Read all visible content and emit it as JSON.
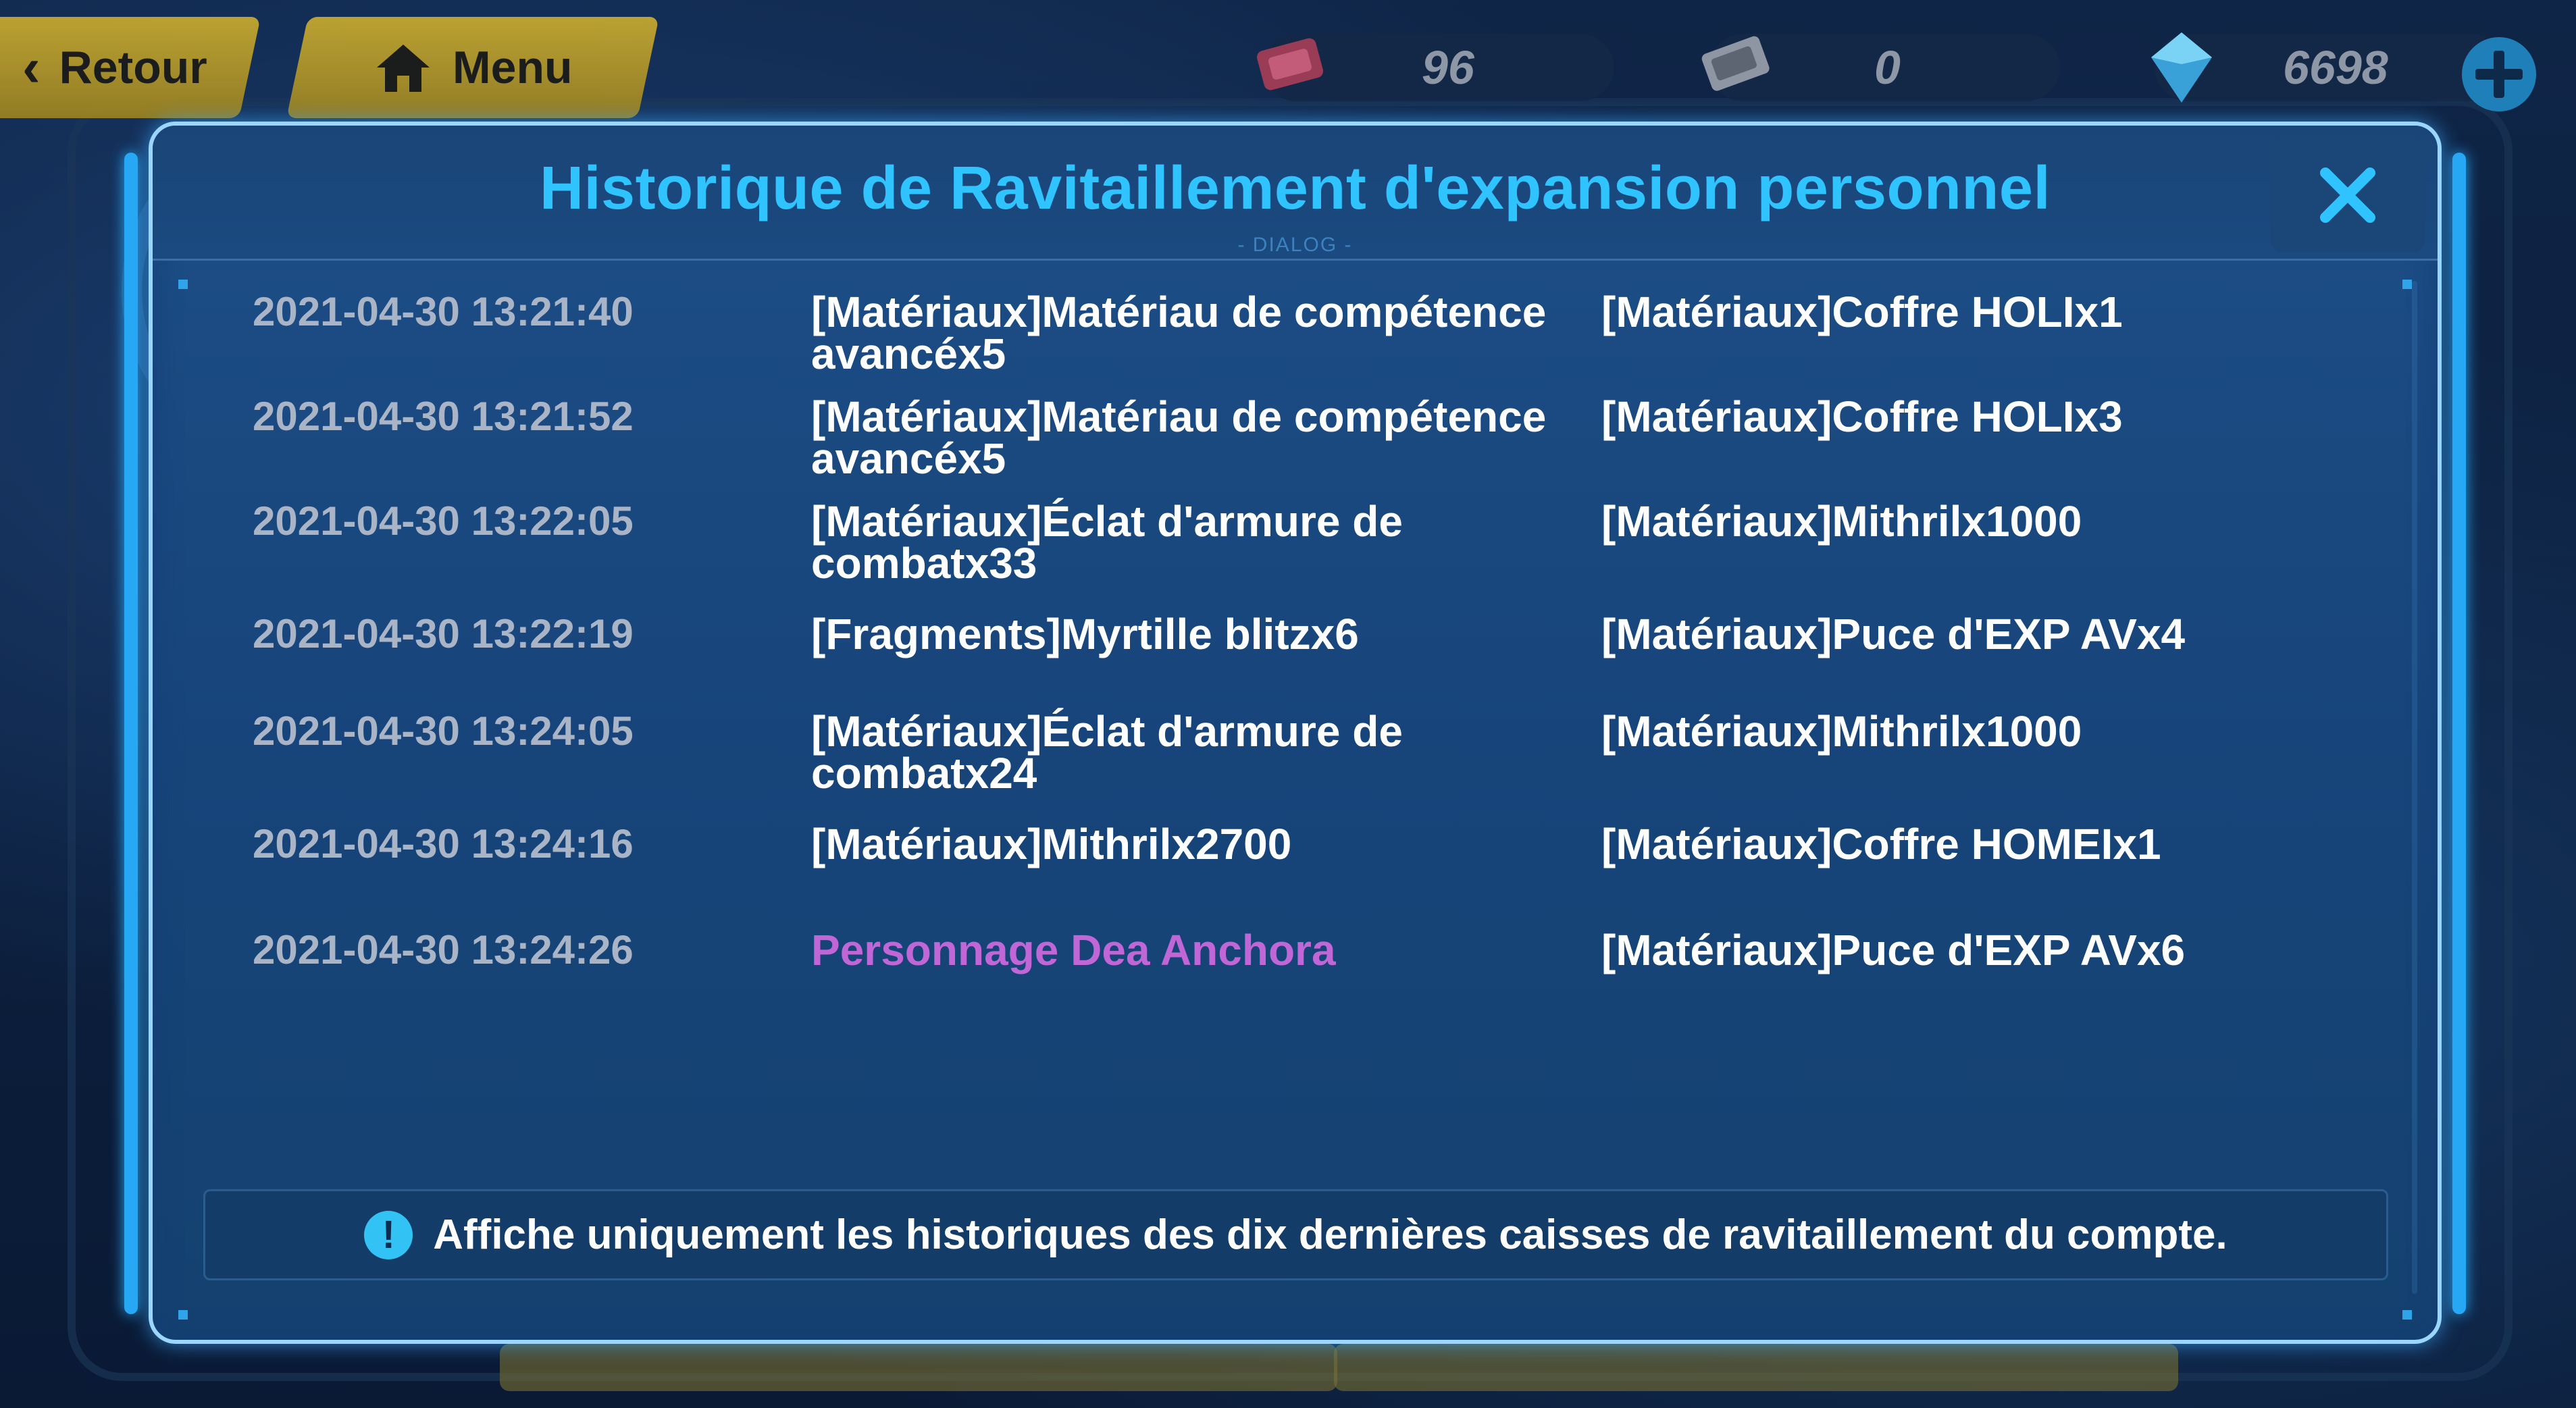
{
  "topbar": {
    "back_label": "Retour",
    "menu_label": "Menu",
    "resources": [
      {
        "icon": "ticket-icon",
        "value": "96"
      },
      {
        "icon": "card-icon",
        "value": "0"
      },
      {
        "icon": "crystal-icon",
        "value": "6698"
      }
    ]
  },
  "dialog": {
    "title": "Historique de Ravitaillement d'expansion personnel",
    "subtitle": "- DIALOG -",
    "rows": [
      {
        "date": "2021-04-30 13:21:40",
        "item_a": "[Matériaux]Matériau de compétence avancéx5",
        "item_b": "[Matériaux]Coffre HOLIx1",
        "highlight": false
      },
      {
        "date": "2021-04-30 13:21:52",
        "item_a": "[Matériaux]Matériau de compétence avancéx5",
        "item_b": "[Matériaux]Coffre HOLIx3",
        "highlight": false
      },
      {
        "date": "2021-04-30 13:22:05",
        "item_a": "[Matériaux]Éclat d'armure de combatx33",
        "item_b": "[Matériaux]Mithrilx1000",
        "highlight": false
      },
      {
        "date": "2021-04-30 13:22:19",
        "item_a": "[Fragments]Myrtille blitzx6",
        "item_b": "[Matériaux]Puce d'EXP AVx4",
        "highlight": false
      },
      {
        "date": "2021-04-30 13:24:05",
        "item_a": "[Matériaux]Éclat d'armure de combatx24",
        "item_b": "[Matériaux]Mithrilx1000",
        "highlight": false
      },
      {
        "date": "2021-04-30 13:24:16",
        "item_a": "[Matériaux]Mithrilx2700",
        "item_b": "[Matériaux]Coffre HOMEIx1",
        "highlight": false
      },
      {
        "date": "2021-04-30 13:24:26",
        "item_a": "Personnage Dea Anchora",
        "item_b": "[Matériaux]Puce d'EXP AVx6",
        "highlight": true
      }
    ],
    "info_text": "Affiche uniquement les historiques des dix dernières caisses de ravitaillement du compte.",
    "info_icon": "exclamation-icon"
  },
  "colors": {
    "title": "#2fc3ff",
    "highlight": "#c066d6",
    "date": "#a9b4c6",
    "border": "#9ad6ff"
  }
}
